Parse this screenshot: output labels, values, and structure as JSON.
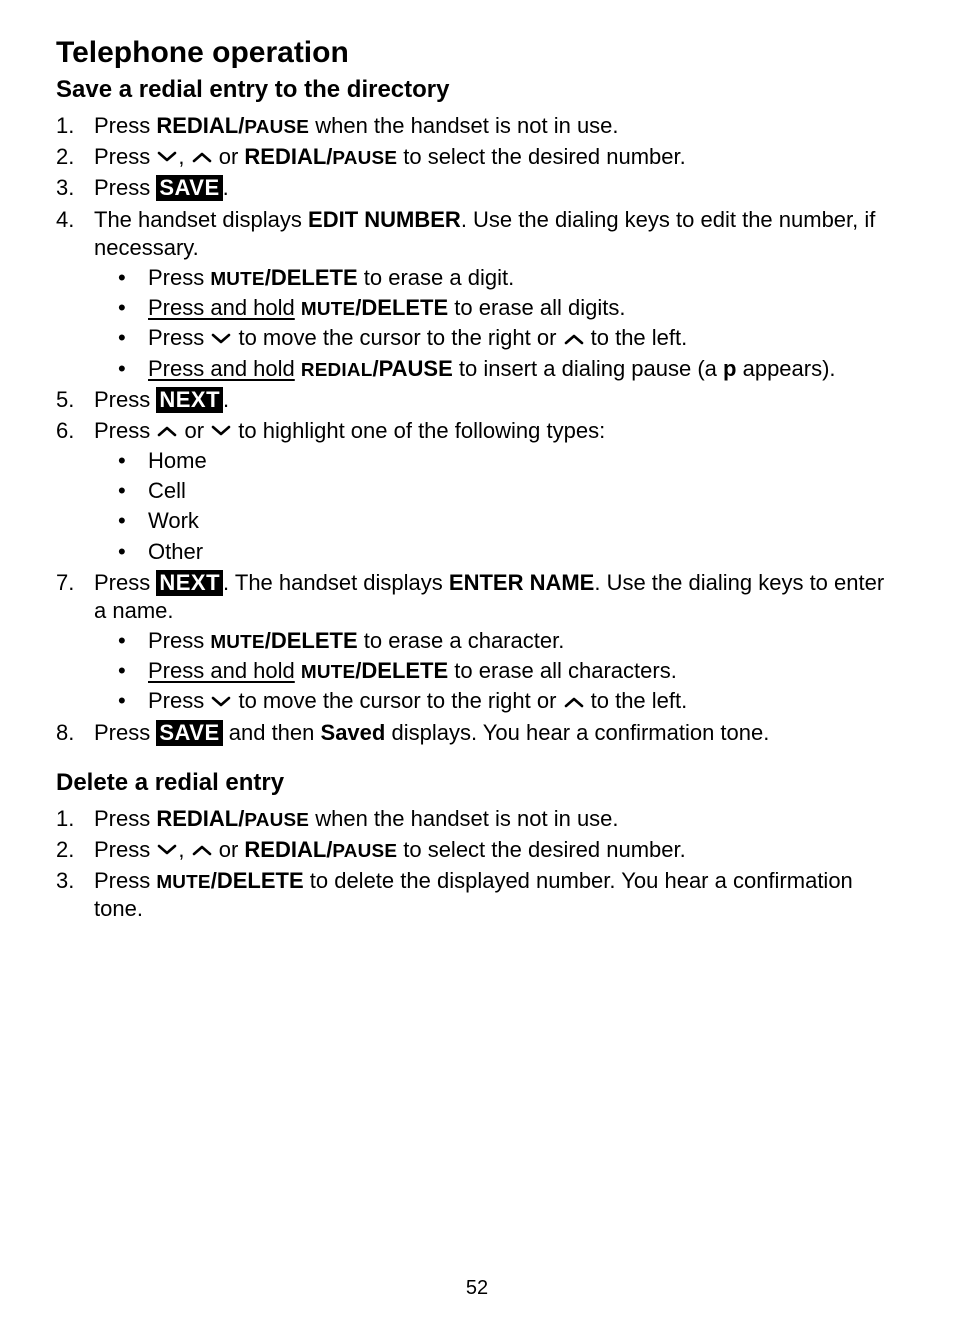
{
  "title": "Telephone operation",
  "section1": {
    "heading": "Save a redial entry to the directory",
    "steps": {
      "s1": {
        "a": "Press ",
        "b": "REDIAL/",
        "c": "PAUSE",
        "d": " when the handset is not in use."
      },
      "s2": {
        "a": "Press ",
        "b": ", ",
        "c": " or ",
        "d": "REDIAL/",
        "e": "PAUSE",
        "f": " to select the desired number."
      },
      "s3": {
        "a": "Press ",
        "b": "SAVE",
        "c": "."
      },
      "s4": {
        "a": "The handset displays ",
        "b": "EDIT NUMBER",
        "c": ". Use the dialing keys to edit the number, if necessary.",
        "sub": {
          "i1": {
            "a": "Press ",
            "b": "MUTE",
            "c": "/DELETE",
            "d": " to erase a digit."
          },
          "i2": {
            "a": "Press and hold",
            "b": " ",
            "c": "MUTE",
            "d": "/DELETE",
            "e": " to erase all digits."
          },
          "i3": {
            "a": "Press ",
            "b": " to move the cursor to the right or ",
            "c": " to the left."
          },
          "i4": {
            "a": "Press and hold",
            "b": " ",
            "c": "REDIAL",
            "d": "/PAUSE",
            "e": " to insert a dialing pause (a ",
            "f": "p",
            "g": " appears)."
          }
        }
      },
      "s5": {
        "a": "Press ",
        "b": "NEXT",
        "c": "."
      },
      "s6": {
        "a": "Press ",
        "b": " or ",
        "c": " to highlight one of the following types:",
        "sub": {
          "i1": "Home",
          "i2": "Cell",
          "i3": "Work",
          "i4": "Other"
        }
      },
      "s7": {
        "a": "Press ",
        "b": "NEXT",
        "c": ". The handset displays ",
        "d": "ENTER NAME",
        "e": ". Use the dialing keys to enter a name.",
        "sub": {
          "i1": {
            "a": "Press ",
            "b": "MUTE",
            "c": "/DELETE",
            "d": " to erase a character."
          },
          "i2": {
            "a": "Press and hold",
            "b": " ",
            "c": "MUTE",
            "d": "/DELETE",
            "e": " to erase all characters."
          },
          "i3": {
            "a": "Press ",
            "b": " to move the cursor to the right or ",
            "c": " to the left."
          }
        }
      },
      "s8": {
        "a": "Press ",
        "b": "SAVE",
        "c": " and then ",
        "d": "Saved",
        "e": " displays. You hear a confirmation tone."
      }
    }
  },
  "section2": {
    "heading": "Delete a redial entry",
    "steps": {
      "s1": {
        "a": "Press ",
        "b": "REDIAL/",
        "c": "PAUSE",
        "d": " when the handset is not in use."
      },
      "s2": {
        "a": "Press ",
        "b": ", ",
        "c": " or ",
        "d": "REDIAL/",
        "e": "PAUSE",
        "f": " to select the desired number."
      },
      "s3": {
        "a": "Press ",
        "b": "MUTE",
        "c": "/DELETE",
        "d": " to delete the displayed number. You hear a confirmation tone."
      }
    }
  },
  "pageNumber": "52"
}
